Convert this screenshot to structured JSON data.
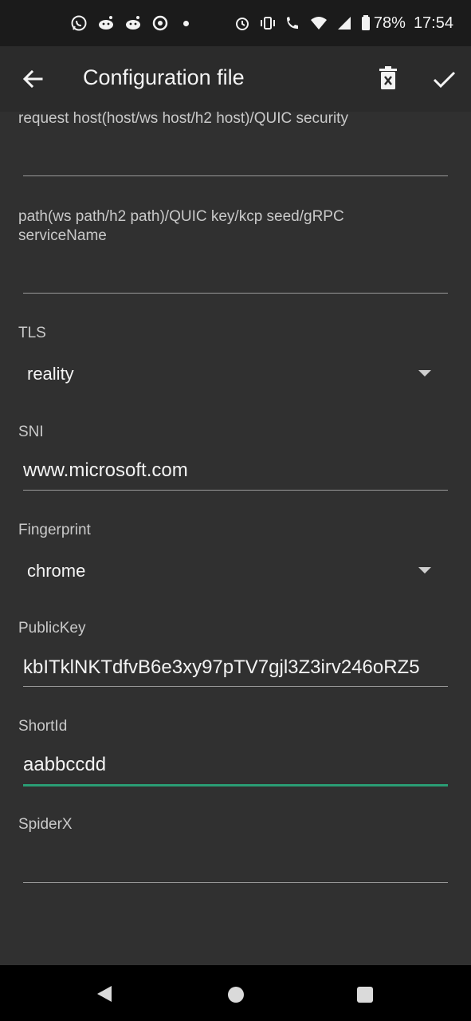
{
  "status_bar": {
    "left_icons": [
      "whatsapp-icon",
      "reddit-icon",
      "reddit-icon",
      "app-icon"
    ],
    "battery_percent": "78%",
    "time": "17:54"
  },
  "app_bar": {
    "title": "Configuration file",
    "back_icon": "arrow-left-icon",
    "delete_icon": "delete-icon",
    "save_icon": "check-icon"
  },
  "form": {
    "host_label": "request host(host/ws host/h2 host)/QUIC security",
    "host_value": "",
    "path_label_line1": "path(ws path/h2 path)/QUIC key/kcp seed/gRPC",
    "path_label_line2": "serviceName",
    "path_value": "",
    "tls_label": "TLS",
    "tls_value": "reality",
    "sni_label": "SNI",
    "sni_value": "www.microsoft.com",
    "fingerprint_label": "Fingerprint",
    "fingerprint_value": "chrome",
    "publickey_label": "PublicKey",
    "publickey_value": "kbITklNKTdfvB6e3xy97pTV7gjl3Z3irv246oRZ5",
    "shortid_label": "ShortId",
    "shortid_value": "aabbccdd",
    "spiderx_label": "SpiderX",
    "spiderx_value": ""
  },
  "colors": {
    "background": "#303030",
    "app_bar": "#2b2b2b",
    "status_bar": "#1b1b1b",
    "accent": "#2a9d74",
    "nav_bar": "#000000"
  }
}
